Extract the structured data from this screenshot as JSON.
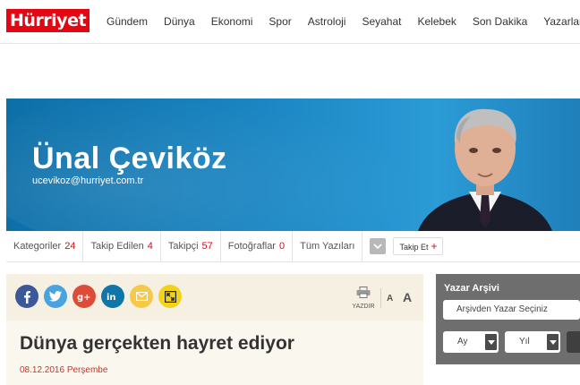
{
  "header": {
    "logo_text": "Hürriyet",
    "nav": [
      "Gündem",
      "Dünya",
      "Ekonomi",
      "Spor",
      "Astroloji",
      "Seyahat",
      "Kelebek",
      "Son Dakika",
      "Yazarlar"
    ]
  },
  "author": {
    "name": "Ünal Çeviköz",
    "email": "ucevikoz@hurriyet.com.tr"
  },
  "stats": {
    "categories_label": "Kategoriler",
    "categories_count": "24",
    "following_label": "Takip Edilen",
    "following_count": "4",
    "followers_label": "Takipçi",
    "followers_count": "57",
    "photos_label": "Fotoğraflar",
    "photos_count": "0",
    "all_posts_label": "Tüm Yazıları",
    "follow_label": "Takip Et",
    "follow_plus": "+"
  },
  "article": {
    "share_icons": [
      "facebook-icon",
      "twitter-icon",
      "google-plus-icon",
      "linkedin-icon",
      "email-icon",
      "expand-icon"
    ],
    "print_label": "YAZDIR",
    "font_small": "A",
    "font_large": "A",
    "title": "Dünya gerçekten hayret ediyor",
    "date": "08.12.2016 Perşembe"
  },
  "archive": {
    "title": "Yazar Arşivi",
    "author_select": "Arşivden Yazar Seçiniz",
    "month_select": "Ay",
    "year_select": "Yıl"
  },
  "colors": {
    "brand_red": "#e30613",
    "banner_blue": "#1b86c3",
    "article_bg": "#f5f0e1",
    "archive_bg": "#6e6e6e"
  }
}
